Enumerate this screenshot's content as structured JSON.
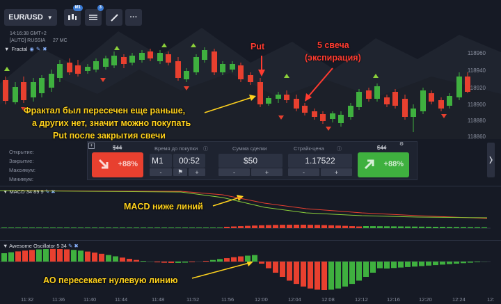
{
  "toolbar": {
    "pair": "EUR/USD",
    "timeframe_badge": "M1",
    "indicators_badge": "3",
    "more": "···"
  },
  "info": {
    "time": "14:16:38 GMT+2",
    "region": "[AUTO] RUSSIA",
    "ping": "27 MC"
  },
  "main_indicator": {
    "name": "Fractal"
  },
  "price_axis": [
    "118960",
    "118940",
    "118920",
    "118900",
    "118880",
    "118860"
  ],
  "side_labels": [
    "Открытие:",
    "Закрытие:",
    "Максимум:",
    "Минимум:"
  ],
  "trade": {
    "put_amount": "$44",
    "put_percent": "+88%",
    "call_amount": "$44",
    "call_percent": "+88%",
    "time_label": "Время до покупки",
    "period": "M1",
    "countdown": "00:52",
    "amount_label": "Сумма сделки",
    "amount": "$50",
    "strike_label": "Страйк-цена",
    "strike": "1.17522",
    "minus": "-",
    "plus": "+"
  },
  "macd": {
    "title": "MACD 34 89 9"
  },
  "ao": {
    "title": "Awesome Oscillator 5 34"
  },
  "time_axis": [
    "11:32",
    "11:36",
    "11:40",
    "11:44",
    "11:48",
    "11:52",
    "11:56",
    "12:00",
    "12:04",
    "12:08",
    "12:12",
    "12:16",
    "12:20",
    "12:24",
    "12:"
  ],
  "annotations": {
    "put": "Put",
    "candles5_line1": "5 свеча",
    "candles5_line2": "(экспирация)",
    "fractal_line1": "Фрактал был пересечен еще раньше,",
    "fractal_line2": "а других нет, значит можно покупать",
    "fractal_line3": "Put после закрытия свечи",
    "macd_note": "MACD ниже линий",
    "ao_note": "АО пересекает нулевую линию"
  },
  "colors": {
    "up": "#3fb03f",
    "down": "#e8402f",
    "annotation": "#ffd21e",
    "background": "#161a25"
  }
}
